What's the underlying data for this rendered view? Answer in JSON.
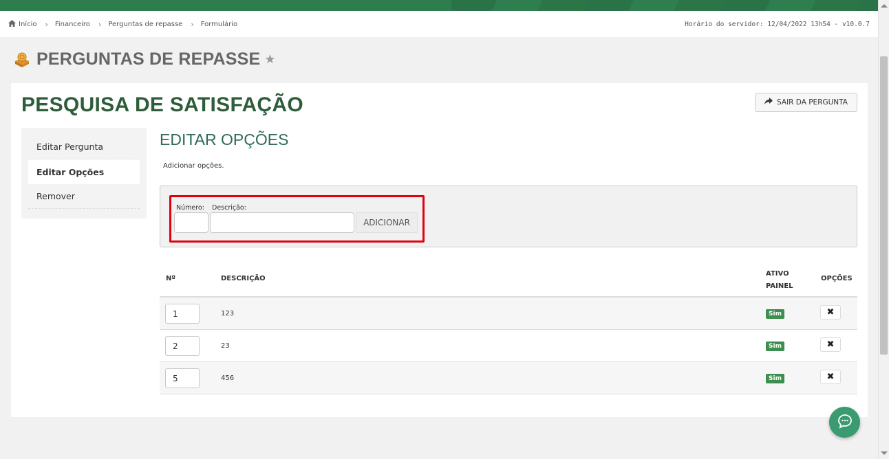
{
  "breadcrumb": {
    "items": [
      "Início",
      "Financeiro",
      "Perguntas de repasse",
      "Formulário"
    ]
  },
  "server_info": "Horário do servidor: 12/04/2022 13h54 - v10.0.7",
  "page": {
    "title": "PERGUNTAS DE REPASSE"
  },
  "card": {
    "title": "PESQUISA DE SATISFAÇÃO",
    "exit_label": "SAIR DA PERGUNTA"
  },
  "sidenav": {
    "items": [
      {
        "label": "Editar Pergunta",
        "active": false
      },
      {
        "label": "Editar Opções",
        "active": true
      },
      {
        "label": "Remover",
        "active": false
      }
    ]
  },
  "section": {
    "title": "EDITAR OPÇÕES",
    "description": "Adicionar opções."
  },
  "form": {
    "number_label": "Número:",
    "description_label": "Descrição:",
    "number_value": "",
    "description_value": "",
    "add_label": "ADICIONAR"
  },
  "table": {
    "headers": {
      "num": "Nº",
      "desc": "DESCRIÇÃO",
      "ativo_line1": "ATIVO",
      "ativo_line2": "PAINEL",
      "opcoes": "OPÇÕES"
    },
    "rows": [
      {
        "num": "1",
        "desc": "123",
        "ativo": "Sim"
      },
      {
        "num": "2",
        "desc": "23",
        "ativo": "Sim"
      },
      {
        "num": "5",
        "desc": "456",
        "ativo": "Sim"
      }
    ]
  },
  "colors": {
    "brand_green": "#2e5d3a",
    "badge_green": "#3e8e4f",
    "highlight_red": "#e00010",
    "chat_green": "#3a9a70"
  },
  "icons": {
    "home": "home-icon",
    "star": "star-icon",
    "share": "share-icon",
    "delete": "close-icon",
    "chat": "chat-icon"
  }
}
